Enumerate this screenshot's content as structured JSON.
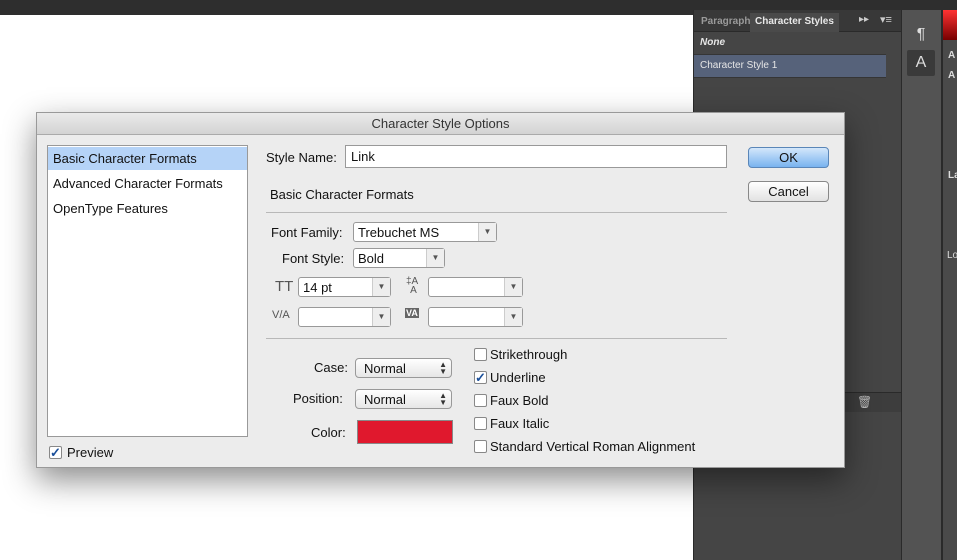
{
  "panel": {
    "tabs": [
      "Paragraph",
      "Character Styles"
    ],
    "styles": [
      "None",
      "Character Style 1"
    ],
    "right_labels": [
      "A",
      "A",
      "La",
      "Lo"
    ]
  },
  "dialog": {
    "title": "Character Style Options",
    "sections": [
      "Basic Character Formats",
      "Advanced Character Formats",
      "OpenType Features"
    ],
    "preview_label": "Preview",
    "preview_checked": true,
    "style_name_label": "Style Name:",
    "style_name_value": "Link",
    "section_heading": "Basic Character Formats",
    "font_family_label": "Font Family:",
    "font_family_value": "Trebuchet MS",
    "font_style_label": "Font Style:",
    "font_style_value": "Bold",
    "size_value": "14 pt",
    "leading_value": "",
    "kerning_value": "",
    "tracking_value": "",
    "case_label": "Case:",
    "case_value": "Normal",
    "position_label": "Position:",
    "position_value": "Normal",
    "color_label": "Color:",
    "color_value": "#e0182d",
    "checkboxes": [
      {
        "label": "Strikethrough",
        "checked": false
      },
      {
        "label": "Underline",
        "checked": true
      },
      {
        "label": "Faux Bold",
        "checked": false
      },
      {
        "label": "Faux Italic",
        "checked": false
      },
      {
        "label": "Standard Vertical Roman Alignment",
        "checked": false
      }
    ],
    "ok_label": "OK",
    "cancel_label": "Cancel"
  }
}
